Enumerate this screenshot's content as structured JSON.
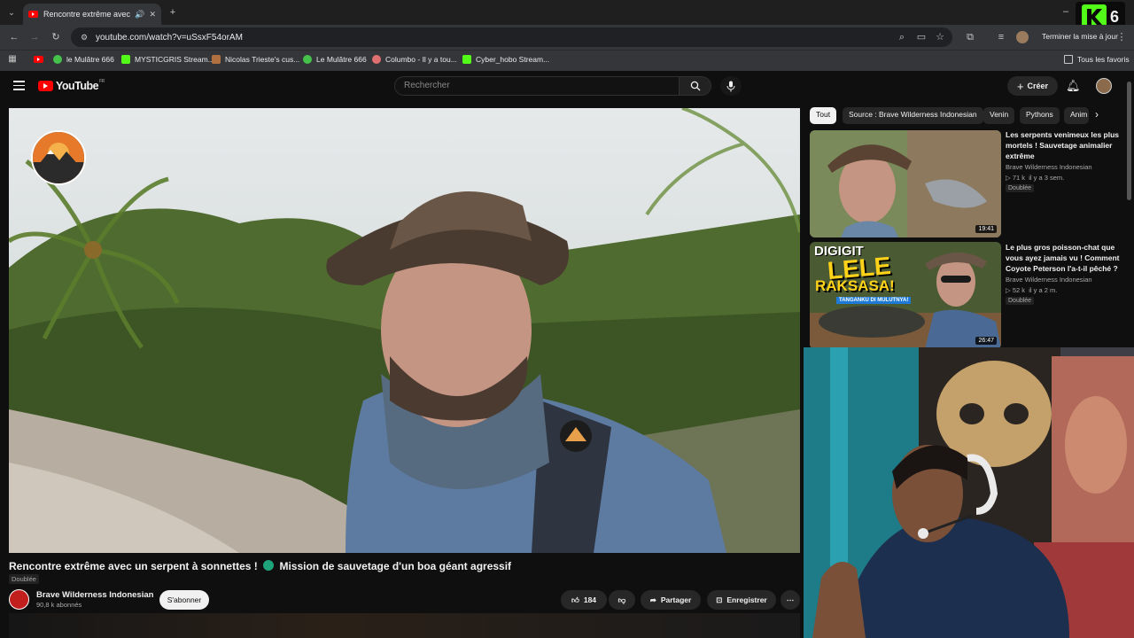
{
  "browser": {
    "tab_title": "Rencontre extrême avec un",
    "url": "youtube.com/watch?v=uSsxF54orAM",
    "update_label": "Terminer la mise à jour",
    "bookmarks": [
      {
        "label": "le Mulâtre 666",
        "color": "#45c24a"
      },
      {
        "label": "MYSTICGRIS Stream...",
        "color": "#53fc18"
      },
      {
        "label": "Nicolas Trieste's cus...",
        "color": "#b07040"
      },
      {
        "label": "Le Mulâtre 666",
        "color": "#45c24a"
      },
      {
        "label": "Columbo - Il y a tou...",
        "color": "#e07070"
      },
      {
        "label": "Cyber_hobo Stream...",
        "color": "#53fc18"
      }
    ],
    "all_bookmarks": "Tous les favoris"
  },
  "youtube": {
    "logo_text": "YouTube",
    "region": "FR",
    "search_placeholder": "Rechercher",
    "create_label": "Créer"
  },
  "video": {
    "title_part1": "Rencontre extrême avec un serpent à sonnettes !",
    "title_part2": "Mission de sauvetage d'un boa géant agressif",
    "dubbed": "Doublée",
    "channel": "Brave Wilderness Indonesian",
    "subscribers": "90,8 k abonnés",
    "subscribe_label": "S'abonner",
    "likes": "184",
    "share_label": "Partager",
    "save_label": "Enregistrer"
  },
  "chips": [
    "Tout",
    "Source : Brave Wilderness Indonesian",
    "Venin",
    "Pythons",
    "Anim"
  ],
  "related": [
    {
      "title": "Les serpents venimeux les plus mortels ! Sauvetage animalier extrême",
      "channel": "Brave Wilderness Indonesian",
      "views": "71 k",
      "age": "il y a 3 sem.",
      "badge": "Doublée",
      "duration": "19:41"
    },
    {
      "title": "Le plus gros poisson-chat que vous ayez jamais vu ! Comment Coyote Peterson l'a-t-il pêché ?",
      "channel": "Brave Wilderness Indonesian",
      "views": "52 k",
      "age": "il y a 2 m.",
      "badge": "Doublée",
      "duration": "26:47",
      "thumb_text_1": "DIGIGIT",
      "thumb_text_2": "LELE",
      "thumb_text_3": "RAKSASA!",
      "thumb_text_4": "TANGANKU DI MULUTNYA!"
    }
  ],
  "overlay": {
    "k_label": "6"
  }
}
